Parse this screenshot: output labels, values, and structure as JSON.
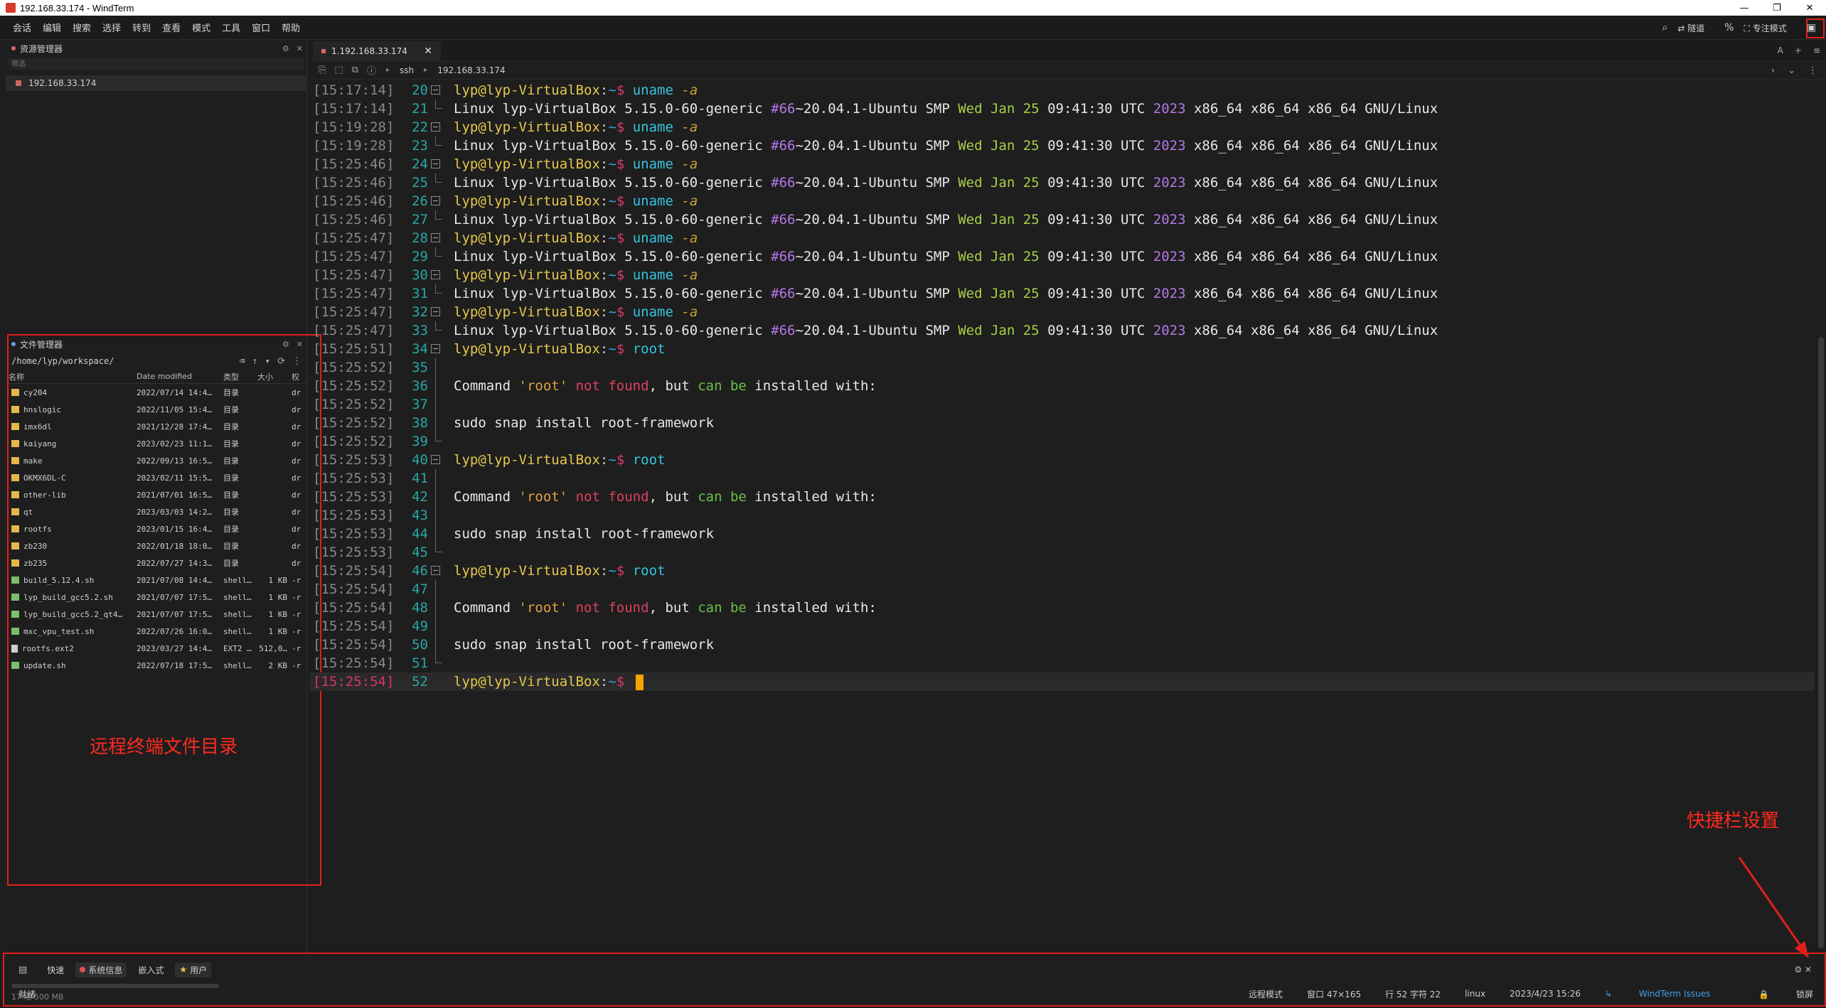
{
  "window": {
    "title": "192.168.33.174 - WindTerm",
    "controls": [
      "—",
      "❐",
      "✕"
    ]
  },
  "menu": {
    "items": [
      "会话",
      "编辑",
      "搜索",
      "选择",
      "转到",
      "查看",
      "模式",
      "工具",
      "窗口",
      "帮助"
    ],
    "right": {
      "tunnel": "隧道",
      "focus_mode": "专注模式"
    }
  },
  "session_panel": {
    "title": "资源管理器",
    "filter_placeholder": "筛选",
    "session": "192.168.33.174"
  },
  "file_panel": {
    "title": "文件管理器",
    "path": "/home/lyp/workspace/",
    "columns": [
      "名称",
      "Date modified",
      "类型",
      "大小",
      "权"
    ],
    "rows": [
      {
        "name": "cy204",
        "date": "2022/07/14 14:4…",
        "type": "目录",
        "size": "",
        "perm": "dr",
        "kind": "folder"
      },
      {
        "name": "hnslogic",
        "date": "2022/11/05 15:4…",
        "type": "目录",
        "size": "",
        "perm": "dr",
        "kind": "folder"
      },
      {
        "name": "imx6dl",
        "date": "2021/12/28 17:4…",
        "type": "目录",
        "size": "",
        "perm": "dr",
        "kind": "folder"
      },
      {
        "name": "kaiyang",
        "date": "2023/02/23 11:1…",
        "type": "目录",
        "size": "",
        "perm": "dr",
        "kind": "folder"
      },
      {
        "name": "make",
        "date": "2022/09/13 16:5…",
        "type": "目录",
        "size": "",
        "perm": "dr",
        "kind": "folder"
      },
      {
        "name": "OKMX6DL-C",
        "date": "2023/02/11 15:5…",
        "type": "目录",
        "size": "",
        "perm": "dr",
        "kind": "folder"
      },
      {
        "name": "other-lib",
        "date": "2021/07/01 16:5…",
        "type": "目录",
        "size": "",
        "perm": "dr",
        "kind": "folder"
      },
      {
        "name": "qt",
        "date": "2023/03/03 14:2…",
        "type": "目录",
        "size": "",
        "perm": "dr",
        "kind": "folder"
      },
      {
        "name": "rootfs",
        "date": "2023/01/15 16:4…",
        "type": "目录",
        "size": "",
        "perm": "dr",
        "kind": "folder"
      },
      {
        "name": "zb230",
        "date": "2022/01/18 18:0…",
        "type": "目录",
        "size": "",
        "perm": "dr",
        "kind": "folder"
      },
      {
        "name": "zb235",
        "date": "2022/07/27 14:3…",
        "type": "目录",
        "size": "",
        "perm": "dr",
        "kind": "folder"
      },
      {
        "name": "build_5.12.4.sh",
        "date": "2021/07/08 14:4…",
        "type": "shell…",
        "size": "1 KB",
        "perm": "-r",
        "kind": "shell"
      },
      {
        "name": "lyp_build_gcc5.2.sh",
        "date": "2021/07/07 17:5…",
        "type": "shell…",
        "size": "1 KB",
        "perm": "-r",
        "kind": "shell"
      },
      {
        "name": "lyp_build_gcc5.2_qt4…",
        "date": "2021/07/07 17:5…",
        "type": "shell…",
        "size": "1 KB",
        "perm": "-r",
        "kind": "shell"
      },
      {
        "name": "mxc_vpu_test.sh",
        "date": "2022/07/26 16:0…",
        "type": "shell…",
        "size": "1 KB",
        "perm": "-r",
        "kind": "shell"
      },
      {
        "name": "rootfs.ext2",
        "date": "2023/03/27 14:4…",
        "type": "EXT2 …",
        "size": "512,0…",
        "perm": "-r",
        "kind": "file"
      },
      {
        "name": "update.sh",
        "date": "2022/07/18 17:5…",
        "type": "shell…",
        "size": "2 KB",
        "perm": "-r",
        "kind": "shell"
      }
    ],
    "status": "17 项 500 MB"
  },
  "annotations": {
    "files_label": "远程终端文件目录",
    "quickbar_label": "快捷栏设置"
  },
  "tab": {
    "label": "1.192.168.33.174",
    "close": "✕"
  },
  "toolbar": {
    "crumb1": "ssh",
    "crumb2": "192.168.33.174"
  },
  "terminal": {
    "prompt": {
      "user": "lyp@lyp-VirtualBox",
      "path": "~",
      "dollar": "$"
    },
    "uname_output": {
      "a": "Linux lyp-VirtualBox 5.15.0-60-generic ",
      "b": "#66",
      "c": "~20.04.1-Ubuntu SMP ",
      "d": "Wed Jan 25",
      "e": " 09:41:30 UTC ",
      "f": "2023",
      "g": " x86_64 x86_64 x86_64 GNU/Linux"
    },
    "not_found": {
      "pre": "Command ",
      "q": "'root'",
      "err": "not found",
      "mid": ", but ",
      "ok": "can be",
      "post": " installed with:"
    },
    "snap": "sudo snap install root-framework",
    "lines": [
      {
        "ts": "[15:17:14]",
        "n": "20",
        "kind": "prompt",
        "cmd": "uname",
        "flag": "-a"
      },
      {
        "ts": "[15:17:14]",
        "n": "21",
        "kind": "uname"
      },
      {
        "ts": "[15:19:28]",
        "n": "22",
        "kind": "prompt",
        "cmd": "uname",
        "flag": "-a"
      },
      {
        "ts": "[15:19:28]",
        "n": "23",
        "kind": "uname"
      },
      {
        "ts": "[15:25:46]",
        "n": "24",
        "kind": "prompt",
        "cmd": "uname",
        "flag": "-a"
      },
      {
        "ts": "[15:25:46]",
        "n": "25",
        "kind": "uname"
      },
      {
        "ts": "[15:25:46]",
        "n": "26",
        "kind": "prompt",
        "cmd": "uname",
        "flag": "-a"
      },
      {
        "ts": "[15:25:46]",
        "n": "27",
        "kind": "uname"
      },
      {
        "ts": "[15:25:47]",
        "n": "28",
        "kind": "prompt",
        "cmd": "uname",
        "flag": "-a"
      },
      {
        "ts": "[15:25:47]",
        "n": "29",
        "kind": "uname"
      },
      {
        "ts": "[15:25:47]",
        "n": "30",
        "kind": "prompt",
        "cmd": "uname",
        "flag": "-a"
      },
      {
        "ts": "[15:25:47]",
        "n": "31",
        "kind": "uname"
      },
      {
        "ts": "[15:25:47]",
        "n": "32",
        "kind": "prompt",
        "cmd": "uname",
        "flag": "-a"
      },
      {
        "ts": "[15:25:47]",
        "n": "33",
        "kind": "uname"
      },
      {
        "ts": "[15:25:51]",
        "n": "34",
        "kind": "prompt",
        "cmd": "root",
        "flag": ""
      },
      {
        "ts": "[15:25:52]",
        "n": "35",
        "kind": "blank"
      },
      {
        "ts": "[15:25:52]",
        "n": "36",
        "kind": "notfound"
      },
      {
        "ts": "[15:25:52]",
        "n": "37",
        "kind": "blank"
      },
      {
        "ts": "[15:25:52]",
        "n": "38",
        "kind": "snap"
      },
      {
        "ts": "[15:25:52]",
        "n": "39",
        "kind": "blank-end"
      },
      {
        "ts": "[15:25:53]",
        "n": "40",
        "kind": "prompt",
        "cmd": "root",
        "flag": ""
      },
      {
        "ts": "[15:25:53]",
        "n": "41",
        "kind": "blank"
      },
      {
        "ts": "[15:25:53]",
        "n": "42",
        "kind": "notfound"
      },
      {
        "ts": "[15:25:53]",
        "n": "43",
        "kind": "blank"
      },
      {
        "ts": "[15:25:53]",
        "n": "44",
        "kind": "snap"
      },
      {
        "ts": "[15:25:53]",
        "n": "45",
        "kind": "blank-end"
      },
      {
        "ts": "[15:25:54]",
        "n": "46",
        "kind": "prompt",
        "cmd": "root",
        "flag": ""
      },
      {
        "ts": "[15:25:54]",
        "n": "47",
        "kind": "blank"
      },
      {
        "ts": "[15:25:54]",
        "n": "48",
        "kind": "notfound"
      },
      {
        "ts": "[15:25:54]",
        "n": "49",
        "kind": "blank"
      },
      {
        "ts": "[15:25:54]",
        "n": "50",
        "kind": "snap"
      },
      {
        "ts": "[15:25:54]",
        "n": "51",
        "kind": "blank-end"
      },
      {
        "ts": "[15:25:54]",
        "n": "52",
        "kind": "current"
      }
    ]
  },
  "quickbar": {
    "quick": "快速",
    "sysinfo": "系统信息",
    "embedded": "嵌入式",
    "user": "用户"
  },
  "statusbar": {
    "ready": "就绪",
    "remote_mode": "远程模式",
    "window_size": "窗口 47×165",
    "position": "行 52 字符 22",
    "os": "linux",
    "datetime": "2023/4/23 15:26",
    "issues": "WindTerm Issues",
    "lock": "锁屏"
  },
  "colors": {
    "accent_red": "#e0201c",
    "prompt_user": "#e6c74d",
    "command": "#35c4e0",
    "cursor": "#f5a300"
  }
}
